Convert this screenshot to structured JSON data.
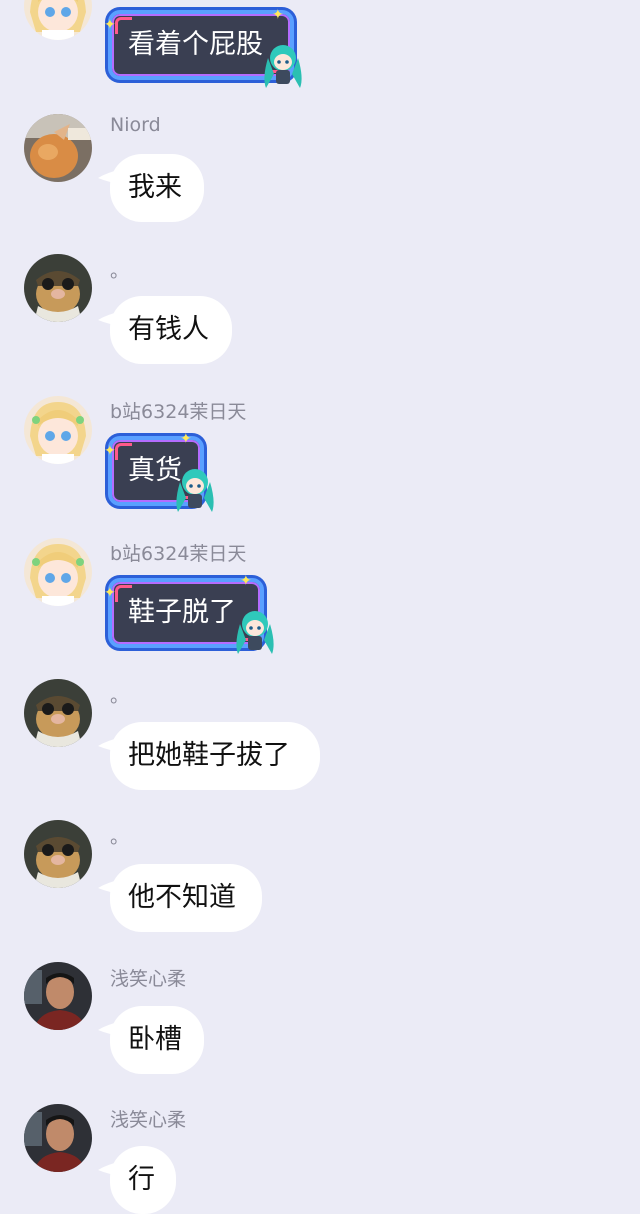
{
  "messages": [
    {
      "sender": "",
      "text": "看着个屁股",
      "style": "vip",
      "avatar": "anime-girl-avatar"
    },
    {
      "sender": "Niord",
      "text": "我来",
      "style": "plain",
      "avatar": "cat-avatar"
    },
    {
      "sender": "。",
      "text": "有钱人",
      "style": "plain",
      "avatar": "pilot-pig-avatar"
    },
    {
      "sender": "b站6324茉日天",
      "text": "真货",
      "style": "vip",
      "avatar": "anime-girl-avatar"
    },
    {
      "sender": "b站6324茉日天",
      "text": "鞋子脱了",
      "style": "vip",
      "avatar": "anime-girl-avatar"
    },
    {
      "sender": "。",
      "text": "把她鞋子拔了",
      "style": "plain",
      "avatar": "pilot-pig-avatar"
    },
    {
      "sender": "。",
      "text": "他不知道",
      "style": "plain",
      "avatar": "pilot-pig-avatar"
    },
    {
      "sender": "浅笑心柔",
      "text": "卧槽",
      "style": "plain",
      "avatar": "man-photo-avatar"
    },
    {
      "sender": "浅笑心柔",
      "text": "行",
      "style": "plain",
      "avatar": "man-photo-avatar"
    }
  ],
  "colors": {
    "background": "#ebebf6",
    "bubble": "#ffffff",
    "vip_bubble": "#3a3f52",
    "vip_border": "#5aa0ff",
    "name_text": "#8a8a98"
  }
}
